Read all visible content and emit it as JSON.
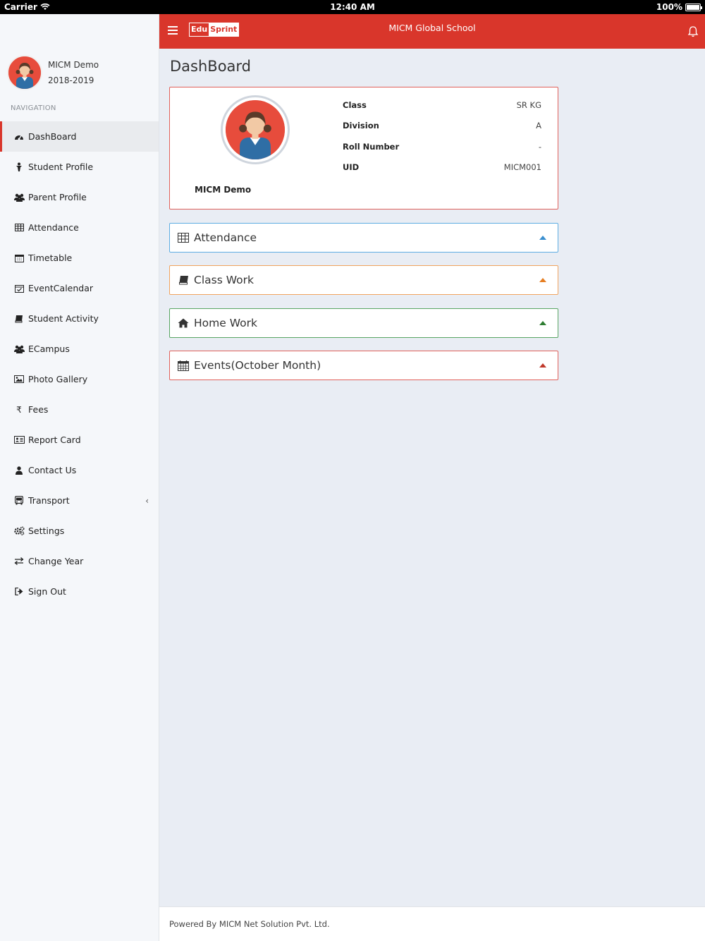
{
  "status_bar": {
    "carrier": "Carrier",
    "time": "12:40 AM",
    "battery": "100%"
  },
  "header": {
    "logo_edu": "Edu",
    "logo_sprint": "Sprint",
    "school_name": "MICM Global School"
  },
  "profile": {
    "name": "MICM Demo",
    "year": "2018-2019"
  },
  "sidebar": {
    "heading": "NAVIGATION",
    "items": [
      {
        "label": "DashBoard",
        "icon": "dashboard-icon"
      },
      {
        "label": "Student Profile",
        "icon": "student-icon"
      },
      {
        "label": "Parent Profile",
        "icon": "users-icon"
      },
      {
        "label": "Attendance",
        "icon": "table-icon"
      },
      {
        "label": "Timetable",
        "icon": "calendar-icon"
      },
      {
        "label": "EventCalendar",
        "icon": "calendar-check-icon"
      },
      {
        "label": "Student Activity",
        "icon": "book-icon"
      },
      {
        "label": "ECampus",
        "icon": "users-icon"
      },
      {
        "label": "Photo Gallery",
        "icon": "image-icon"
      },
      {
        "label": "Fees",
        "icon": "rupee-icon"
      },
      {
        "label": "Report Card",
        "icon": "id-card-icon"
      },
      {
        "label": "Contact Us",
        "icon": "user-icon"
      },
      {
        "label": "Transport",
        "icon": "bus-icon"
      },
      {
        "label": "Settings",
        "icon": "gears-icon"
      },
      {
        "label": "Change Year",
        "icon": "exchange-icon"
      },
      {
        "label": "Sign Out",
        "icon": "sign-out-icon"
      }
    ]
  },
  "main": {
    "title": "DashBoard",
    "student_card": {
      "name": "MICM Demo",
      "fields": [
        {
          "label": "Class",
          "value": "SR KG"
        },
        {
          "label": "Division",
          "value": "A"
        },
        {
          "label": "Roll Number",
          "value": "-"
        },
        {
          "label": "UID",
          "value": "MICM001"
        }
      ]
    },
    "panels": [
      {
        "title": "Attendance",
        "icon": "table-icon",
        "color": "#5dade2"
      },
      {
        "title": "Class Work",
        "icon": "book-icon",
        "color": "#f0a35e"
      },
      {
        "title": "Home Work",
        "icon": "home-icon",
        "color": "#58a563"
      },
      {
        "title": "Events(October Month)",
        "icon": "calendar-icon",
        "color": "#e0605a"
      }
    ]
  },
  "footer": {
    "text": "Powered By MICM Net Solution Pvt. Ltd."
  },
  "colors": {
    "brand_red": "#d9362b",
    "background": "#e9edf4",
    "sidebar": "#f5f7fa"
  }
}
